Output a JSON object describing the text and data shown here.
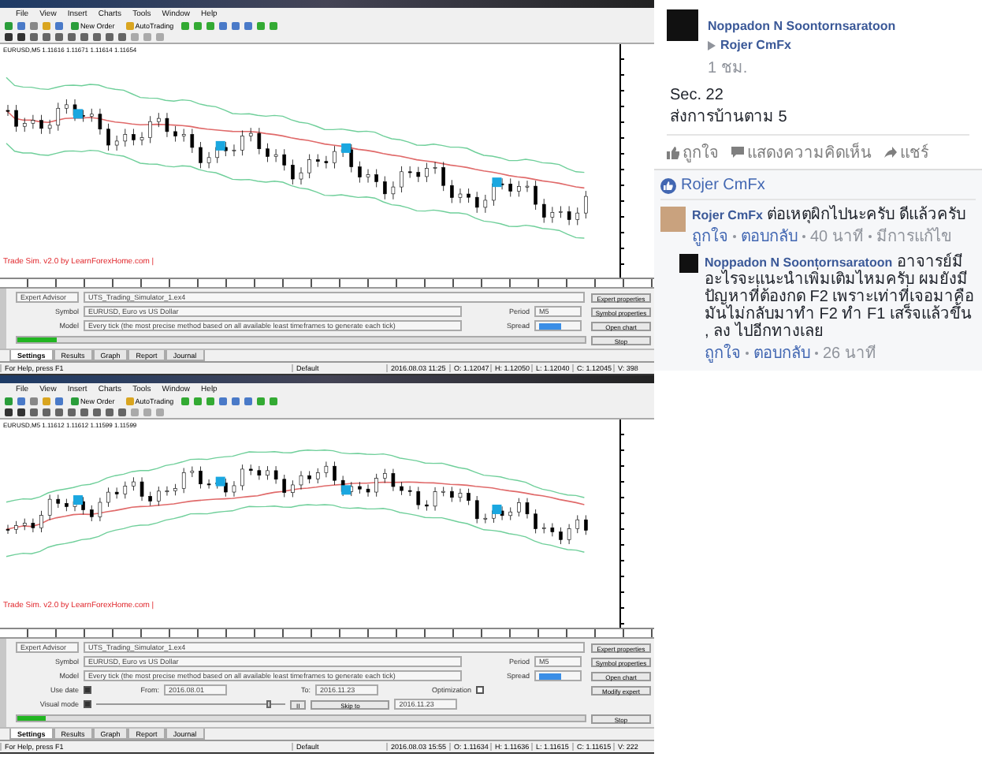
{
  "windows": [
    {
      "menu": [
        "File",
        "View",
        "Insert",
        "Charts",
        "Tools",
        "Window",
        "Help"
      ],
      "toolbar": [
        "New Order",
        "AutoTrading"
      ],
      "symbol_header": "EURUSD,M5 1.11616 1.11671 1.11614 1.11654",
      "chart_label": "Trade Sim. v2.0 by LearnForexHome.com |",
      "tester": {
        "expert_label": "Expert Advisor",
        "expert": "UTS_Trading_Simulator_1.ex4",
        "symbol_label": "Symbol",
        "symbol": "EURUSD, Euro vs US Dollar",
        "model_label": "Model",
        "model": "Every tick (the most precise method based on all available least timeframes to generate each tick)",
        "period_label": "Period",
        "period": "M5",
        "spread_label": "Spread",
        "buttons": [
          "Expert properties",
          "Symbol properties",
          "Open chart"
        ],
        "level": 0.07,
        "stop": "Stop"
      },
      "tabs": [
        {
          "label": "Settings",
          "selected": true
        },
        {
          "label": "Results",
          "selected": false
        },
        {
          "label": "Graph",
          "selected": false
        },
        {
          "label": "Report",
          "selected": false
        },
        {
          "label": "Journal",
          "selected": false
        }
      ],
      "status": [
        "For Help, press F1",
        "Default",
        "2016.08.03 11:25",
        "O: 1.12047",
        "H: 1.12050",
        "L: 1.12040",
        "C: 1.12045",
        "V: 398"
      ]
    },
    {
      "menu": [
        "File",
        "View",
        "Insert",
        "Charts",
        "Tools",
        "Window",
        "Help"
      ],
      "toolbar": [
        "New Order",
        "AutoTrading"
      ],
      "symbol_header": "EURUSD,M5 1.11612 1.11612 1.11599 1.11599",
      "chart_label": "Trade Sim. v2.0 by LearnForexHome.com |",
      "tester": {
        "expert_label": "Expert Advisor",
        "expert": "UTS_Trading_Simulator_1.ex4",
        "symbol_label": "Symbol",
        "symbol": "EURUSD, Euro vs US Dollar",
        "model_label": "Model",
        "model": "Every tick (the most precise method based on all available least timeframes to generate each tick)",
        "period_label": "Period",
        "period": "M5",
        "spread_label": "Spread",
        "buttons": [
          "Expert properties",
          "Symbol properties",
          "Open chart",
          "Modify expert"
        ],
        "level": 0.05,
        "stop": "Stop",
        "dates": {
          "use_label": "Use date",
          "checked": true,
          "from_label": "From:",
          "from": "2016.08.01",
          "to_label": "To:",
          "to": "2016.11.23",
          "optimization_label": "Optimization",
          "optimization": false
        },
        "visual": {
          "label": "Visual mode",
          "checked": true,
          "level": 0.9,
          "pause": "II",
          "skip": "Skip to",
          "skip_date": "2016.11.23"
        }
      },
      "tabs": [
        {
          "label": "Settings",
          "selected": true
        },
        {
          "label": "Results",
          "selected": false
        },
        {
          "label": "Graph",
          "selected": false
        },
        {
          "label": "Report",
          "selected": false
        },
        {
          "label": "Journal",
          "selected": false
        }
      ],
      "status": [
        "For Help, press F1",
        "Default",
        "2016.08.03 15:55",
        "O: 1.11634",
        "H: 1.11636",
        "L: 1.11615",
        "C: 1.11615",
        "V: 222"
      ]
    }
  ],
  "post": {
    "author": "Noppadon N Soontornsaratoon",
    "target": "Rojer CmFx",
    "time": "1 ชม.",
    "lines": [
      "Sec. 22",
      "ส่งการบ้านตาม 5"
    ],
    "actions": [
      "ถูกใจ",
      "แสดงความคิดเห็น",
      "แชร์"
    ]
  },
  "liked_by": "Rojer CmFx",
  "comments": [
    {
      "kind": "top",
      "author": "Rojer CmFx",
      "text": "ต่อเหตุผิกไปนะครับ ดีแล้วครับ",
      "meta": [
        "ถูกใจ",
        "ตอบกลับ",
        "40 นาที",
        "มีการแก้ไข"
      ]
    },
    {
      "kind": "reply",
      "author": "Noppadon N Soontornsaratoon",
      "text": "อาจารย์มีอะไรจะแนะนำเพิ่มเติมไหมครับ ผมยังมีปัญหาที่ต้องกด F2 เพราะเท่าที่เจอมาคือ มันไม่กลับมาทำ F2 ทำ F1 เสร็จแล้วขึ้น , ลง ไปอีกทางเลย",
      "meta": [
        "ถูกใจ",
        "ตอบกลับ",
        "26 นาที"
      ]
    }
  ]
}
